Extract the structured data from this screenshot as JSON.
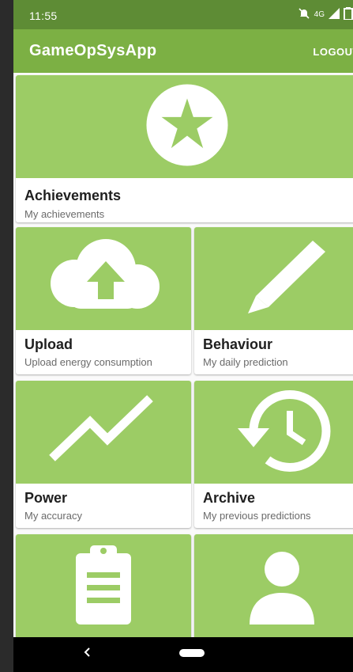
{
  "status_bar": {
    "time": "11:55",
    "network": "4G",
    "icons": [
      "do-not-disturb-icon",
      "signal-icon",
      "battery-icon"
    ]
  },
  "app_bar": {
    "title": "GameOpSysApp",
    "logout_label": "LOGOUT"
  },
  "cards": {
    "achievements": {
      "label": "Achievements",
      "subtitle": "My achievements",
      "icon": "star-badge-icon"
    },
    "upload": {
      "label": "Upload",
      "subtitle": "Upload energy consumption",
      "icon": "cloud-upload-icon"
    },
    "behaviour": {
      "label": "Behaviour",
      "subtitle": "My daily prediction",
      "icon": "pencil-icon"
    },
    "power": {
      "label": "Power",
      "subtitle": "My accuracy",
      "icon": "trending-up-icon"
    },
    "archive": {
      "label": "Archive",
      "subtitle": "My previous predictions",
      "icon": "history-icon"
    },
    "tasks": {
      "icon": "clipboard-icon"
    },
    "profile": {
      "icon": "person-icon"
    }
  },
  "colors": {
    "status_bar": "#5e8c35",
    "app_bar": "#7cb044",
    "tile": "#9ccc65"
  }
}
